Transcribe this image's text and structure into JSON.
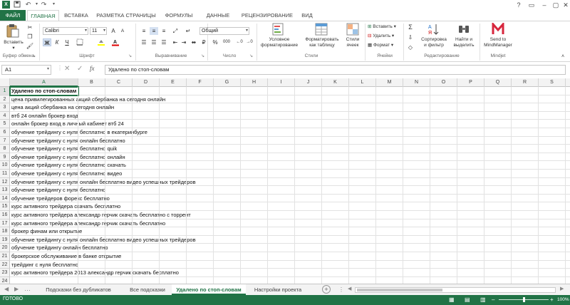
{
  "title_bar": {
    "quick_access": [
      "excel-logo-icon",
      "save-icon",
      "undo-icon",
      "redo-icon",
      "customize-icon"
    ],
    "help": "?"
  },
  "tabs": [
    "ФАЙЛ",
    "ГЛАВНАЯ",
    "ВСТАВКА",
    "РАЗМЕТКА СТРАНИЦЫ",
    "ФОРМУЛЫ",
    "ДАННЫЕ",
    "РЕЦЕНЗИРОВАНИЕ",
    "ВИД"
  ],
  "ribbon": {
    "clipboard": {
      "paste": "Вставить",
      "label": "Буфер обмена"
    },
    "font": {
      "name": "Calibri",
      "size": "11",
      "bold": "Ж",
      "italic": "К",
      "underline": "Ч",
      "grow": "A",
      "shrink": "A",
      "label": "Шрифт"
    },
    "alignment": {
      "label": "Выравнивание"
    },
    "number": {
      "format": "Общий",
      "percent": "%",
      "thousands": "000",
      "label": "Число"
    },
    "styles": {
      "conditional": [
        "Условное",
        "форматирование"
      ],
      "as_table": [
        "Форматировать",
        "как таблицу"
      ],
      "cell_styles": [
        "Стили",
        "ячеек"
      ],
      "label": "Стили"
    },
    "cells": {
      "insert": "Вставить",
      "delete": "Удалить",
      "format": "Формат",
      "label": "Ячейки"
    },
    "editing": {
      "sort": [
        "Сортировка",
        "и фильтр"
      ],
      "find": [
        "Найти и",
        "выделить"
      ],
      "label": "Редактирование"
    },
    "mindjet": {
      "send": [
        "Send to",
        "MindManager"
      ],
      "label": "Mindjet"
    }
  },
  "formula_bar": {
    "name_box": "A1",
    "fx": "fx",
    "content": "Удалено по стоп-словам"
  },
  "columns": [
    "A",
    "B",
    "C",
    "D",
    "E",
    "F",
    "G",
    "H",
    "I",
    "J",
    "K",
    "L",
    "M",
    "N",
    "O",
    "P",
    "Q",
    "R",
    "S"
  ],
  "rows": [
    {
      "n": "1",
      "a": "Удалено по стоп-словам"
    },
    {
      "n": "2",
      "a": "цена привилегированных акций сбербанка на сегодня онлайн"
    },
    {
      "n": "3",
      "a": "цена акций сбербанка на сегодня онлайн"
    },
    {
      "n": "4",
      "a": "втб 24 онлайн брокер вход"
    },
    {
      "n": "5",
      "a": "онлайн брокер вход в личный кабинет втб 24"
    },
    {
      "n": "6",
      "a": "обучение трейдингу с нуля бесплатно в екатеринбурге"
    },
    {
      "n": "7",
      "a": "обучение трейдингу с нуля онлайн бесплатно"
    },
    {
      "n": "8",
      "a": "обучение трейдингу с нуля бесплатно quik"
    },
    {
      "n": "9",
      "a": "обучение трейдингу с нуля бесплатно онлайн"
    },
    {
      "n": "10",
      "a": "обучение трейдингу с нуля бесплатно скачать"
    },
    {
      "n": "11",
      "a": "обучение трейдингу с нуля бесплатно видео"
    },
    {
      "n": "12",
      "a": "обучение трейдингу с нуля онлайн бесплатно видео успешных трейдеров"
    },
    {
      "n": "13",
      "a": "обучение трейдингу с нуля бесплатно"
    },
    {
      "n": "14",
      "a": "обучение трейдеров форекс бесплатно"
    },
    {
      "n": "15",
      "a": "курс активного трейдера скачать бесплатно"
    },
    {
      "n": "16",
      "a": "курс активного трейдера александр герчик скачать бесплатно с торрент"
    },
    {
      "n": "17",
      "a": "курс активного трейдера александр герчик скачать бесплатно"
    },
    {
      "n": "18",
      "a": "брокер финам или открытие"
    },
    {
      "n": "19",
      "a": "обучение трейдингу с нуля онлайн бесплатно видео успешных трейдеров"
    },
    {
      "n": "20",
      "a": "обучение трейдингу онлайн бесплатно"
    },
    {
      "n": "21",
      "a": "брокерское обслуживание в банке открытие"
    },
    {
      "n": "22",
      "a": "трейдинг с нуля бесплатно"
    },
    {
      "n": "23",
      "a": "курс активного трейдера 2013 александр герчик скачать бесплатно"
    },
    {
      "n": "24",
      "a": ""
    }
  ],
  "sheets": [
    "Подсказки без дубликатов",
    "Все подсказки",
    "Удалено по стоп-словам",
    "Настройки проекта"
  ],
  "status": {
    "ready": "ГОТОВО",
    "zoom": "100%"
  },
  "colors": {
    "accent": "#217346"
  }
}
